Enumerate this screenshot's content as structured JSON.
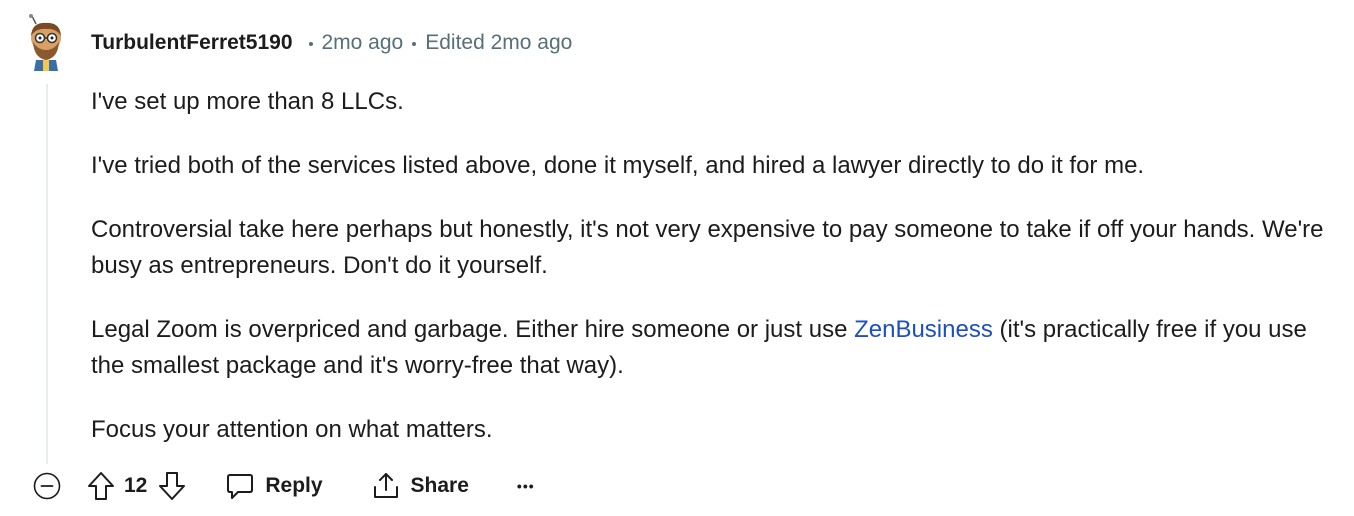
{
  "comment": {
    "author": "TurbulentFerret5190",
    "posted": "2mo ago",
    "edited": "Edited 2mo ago",
    "paragraphs": {
      "p1": "I've set up more than 8 LLCs.",
      "p2": "I've tried both of the services listed above, done it myself, and hired a lawyer directly to do it for me.",
      "p3": "Controversial take here perhaps but honestly, it's not very expensive to pay someone to take if off your hands. We're busy as entrepreneurs. Don't do it yourself.",
      "p4_before": "Legal Zoom is overpriced and garbage. Either hire someone or just use ",
      "p4_link": "ZenBusiness",
      "p4_after": " (it's practically free if you use the smallest package and it's worry-free that way).",
      "p5": "Focus your attention on what matters."
    }
  },
  "actions": {
    "score": "12",
    "reply_label": "Reply",
    "share_label": "Share",
    "more_label": "•••"
  },
  "colors": {
    "text": "#1c1c1c",
    "meta": "#576f76",
    "link": "#1d4fc4",
    "thread_line": "#e5ebee"
  },
  "icons": {
    "collapse": "collapse-minus-icon",
    "upvote": "upvote-arrow-icon",
    "downvote": "downvote-arrow-icon",
    "reply": "speech-bubble-icon",
    "share": "share-upload-icon"
  }
}
